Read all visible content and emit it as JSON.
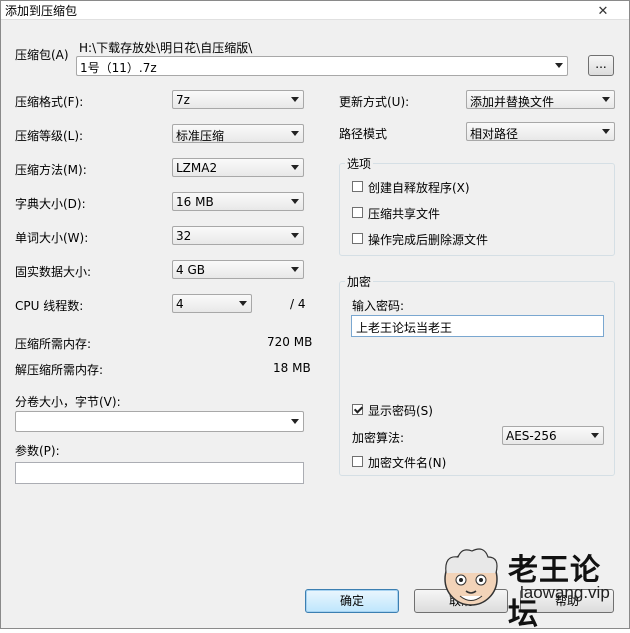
{
  "window": {
    "title": "添加到压缩包",
    "close": "✕"
  },
  "archive": {
    "label": "压缩包(A)",
    "path": "H:\\下载存放处\\明日花\\自压缩版\\",
    "filename": "1号（11）.7z",
    "browse": "..."
  },
  "left": {
    "format": {
      "label": "压缩格式(F):",
      "value": "7z"
    },
    "level": {
      "label": "压缩等级(L):",
      "value": "标准压缩"
    },
    "method": {
      "label": "压缩方法(M):",
      "value": "LZMA2"
    },
    "dict": {
      "label": "字典大小(D):",
      "value": "16 MB"
    },
    "word": {
      "label": "单词大小(W):",
      "value": "32"
    },
    "solid": {
      "label": "固实数据大小:",
      "value": "4 GB"
    },
    "cpu": {
      "label": "CPU 线程数:",
      "value": "4",
      "total": "/ 4"
    },
    "mem_compress": {
      "label": "压缩所需内存:",
      "value": "720 MB"
    },
    "mem_decompress": {
      "label": "解压缩所需内存:",
      "value": "18 MB"
    },
    "split": {
      "label": "分卷大小，字节(V):",
      "value": ""
    },
    "params": {
      "label": "参数(P):",
      "value": ""
    }
  },
  "right": {
    "update": {
      "label": "更新方式(U):",
      "value": "添加并替换文件"
    },
    "pathmode": {
      "label": "路径模式",
      "value": "相对路径"
    },
    "options": {
      "title": "选项",
      "sfx": {
        "label": "创建自释放程序(X)",
        "checked": false
      },
      "shared": {
        "label": "压缩共享文件",
        "checked": false
      },
      "delete": {
        "label": "操作完成后删除源文件",
        "checked": false
      }
    },
    "encryption": {
      "title": "加密",
      "password_label": "输入密码:",
      "password_value": "上老王论坛当老王",
      "show_password": {
        "label": "显示密码(S)",
        "checked": true
      },
      "method_label": "加密算法:",
      "method_value": "AES-256",
      "encrypt_names": {
        "label": "加密文件名(N)",
        "checked": false
      }
    }
  },
  "buttons": {
    "ok": "确定",
    "cancel": "取消",
    "help": "帮助"
  },
  "watermark": {
    "name": "老王论坛",
    "url": "laowang.vip"
  }
}
